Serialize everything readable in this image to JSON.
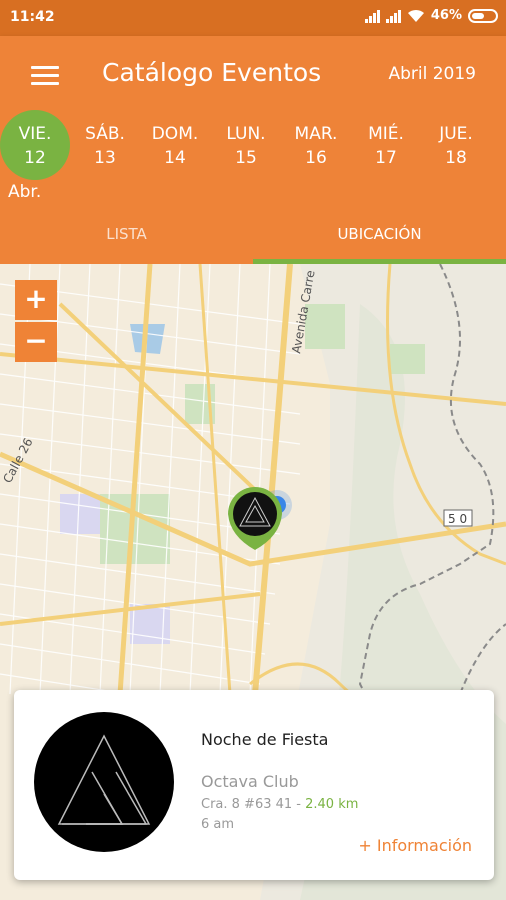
{
  "status": {
    "time": "11:42",
    "battery": "46%"
  },
  "appbar": {
    "title": "Catálogo Eventos",
    "month": "Abril 2019",
    "selected_month_abbr": "Abr."
  },
  "days": [
    {
      "name": "VIE.",
      "num": "12",
      "selected": true
    },
    {
      "name": "SÁB.",
      "num": "13"
    },
    {
      "name": "DOM.",
      "num": "14"
    },
    {
      "name": "LUN.",
      "num": "15"
    },
    {
      "name": "MAR.",
      "num": "16"
    },
    {
      "name": "MIÉ.",
      "num": "17"
    },
    {
      "name": "JUE.",
      "num": "18"
    }
  ],
  "tabs": [
    {
      "label": "LISTA",
      "active": false
    },
    {
      "label": "UBICACIÓN",
      "active": true
    }
  ],
  "map": {
    "zoom_in": "+",
    "zoom_out": "−",
    "labels": {
      "avenue": "Avenida Carre",
      "street": "Calle 26",
      "route": "5 0"
    }
  },
  "card": {
    "event_name": "Noche de Fiesta",
    "venue": "Octava Club",
    "address": "Cra. 8 #63 41 - ",
    "distance": "2.40 km",
    "time": "6 am",
    "more_label": "+ Información"
  },
  "colors": {
    "status": "#d86f22",
    "header": "#ee8338",
    "accent_green": "#7ab342",
    "accent_orange": "#ef8336"
  }
}
